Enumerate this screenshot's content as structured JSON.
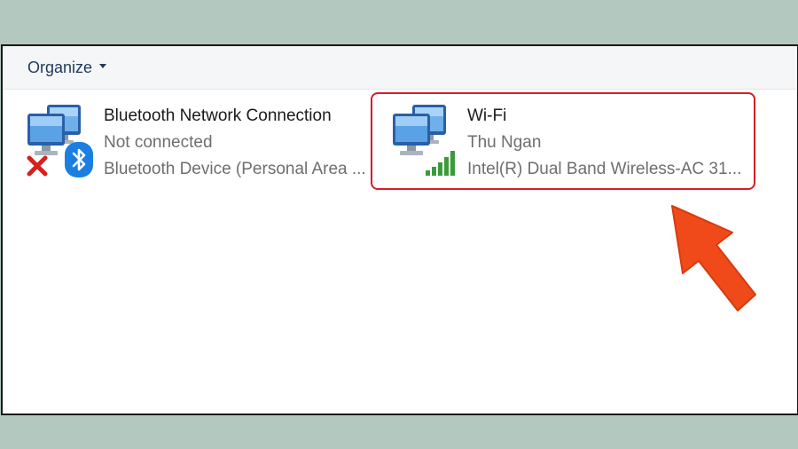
{
  "toolbar": {
    "organize_label": "Organize"
  },
  "connections": [
    {
      "name": "Bluetooth Network Connection",
      "status": "Not connected",
      "device": "Bluetooth Device (Personal Area ...",
      "icon": "network-computer-icon",
      "badges": [
        "disconnected-x-icon",
        "bluetooth-icon"
      ]
    },
    {
      "name": "Wi-Fi",
      "status": "Thu Ngan",
      "device": "Intel(R) Dual Band Wireless-AC 31...",
      "icon": "network-computer-icon",
      "badges": [
        "wifi-signal-bars-icon"
      ]
    }
  ],
  "colors": {
    "background": "#b3c8bf",
    "highlight_border": "#d71c27",
    "arrow": "#f04a1a",
    "bluetooth": "#1a7fe0",
    "wifi_signal": "#3c9a3c"
  }
}
